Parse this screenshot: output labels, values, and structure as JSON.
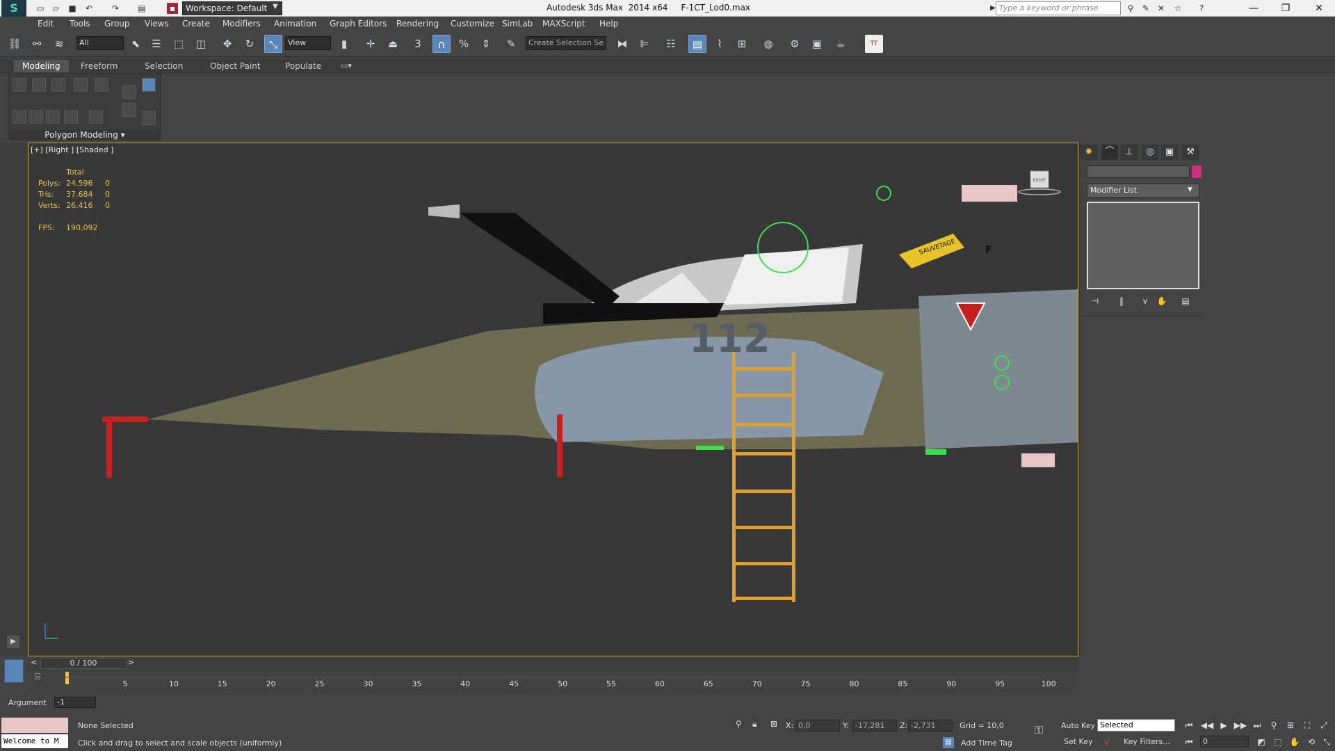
{
  "window": {
    "title": "Autodesk 3ds Max  2014 x64     F-1CT_Lod0.max",
    "workspace": "Workspace: Default",
    "search_placeholder": "Type a keyword or phrase",
    "min": "—",
    "max": "❐",
    "close": "✕"
  },
  "menu": [
    "Edit",
    "Tools",
    "Group",
    "Views",
    "Create",
    "Modifiers",
    "Animation",
    "Graph Editors",
    "Rendering",
    "Customize",
    "SimLab",
    "MAXScript",
    "Help"
  ],
  "toolbar": {
    "selection_filter": "All",
    "ref_coord": "View",
    "named_selection": "Create Selection Se",
    "snap_label": "3"
  },
  "ribbon": {
    "tabs": [
      "Modeling",
      "Freeform",
      "Selection",
      "Object Paint",
      "Populate"
    ],
    "panel_label": "Polygon Modeling ▾"
  },
  "viewport": {
    "label": "[+] [Right ] [Shaded ]",
    "stats": {
      "header": "Total",
      "rows": [
        {
          "label": "Polys:",
          "value": "24.596",
          "sel": "0"
        },
        {
          "label": "Tris:",
          "value": "37.684",
          "sel": "0"
        },
        {
          "label": "Verts:",
          "value": "26.416",
          "sel": "0"
        }
      ],
      "fps_label": "FPS:",
      "fps_value": "190,092"
    },
    "aircraft_number": "112",
    "decal_text": "SAUVETAGE",
    "decal_f": "F",
    "view_cube_label": "RIGHT",
    "colors": {
      "ladder": "#e0a030",
      "fuselage": "#6b6a52",
      "camo_blue": "#8a9bb0"
    }
  },
  "command_panel": {
    "tab_icons": [
      "create-icon",
      "modify-icon",
      "hierarchy-icon",
      "motion-icon",
      "display-icon",
      "utilities-icon"
    ],
    "modifier_list": "Modifier List",
    "swatch_color": "#cc2f7b"
  },
  "timeline": {
    "frame_display": "0 / 100",
    "ticks": [
      "5",
      "10",
      "15",
      "20",
      "25",
      "30",
      "35",
      "40",
      "45",
      "50",
      "55",
      "60",
      "65",
      "70",
      "75",
      "80",
      "85",
      "90",
      "95",
      "100"
    ]
  },
  "status": {
    "argument_label": "Argument",
    "argument_value": "-1",
    "maxscript_text": "Welcome to M",
    "selection_status": "None Selected",
    "prompt": "Click and drag to select and scale objects (uniformly)",
    "x_label": "X:",
    "x_value": "0,0",
    "y_label": "Y:",
    "y_value": "-17,281",
    "z_label": "Z:",
    "z_value": "-2,731",
    "grid": "Grid = 10,0",
    "add_time_tag": "Add Time Tag",
    "auto_key": "Auto Key",
    "set_key": "Set Key",
    "selected_combo": "Selected",
    "key_filters": "Key Filters...",
    "frame_value": "0"
  }
}
